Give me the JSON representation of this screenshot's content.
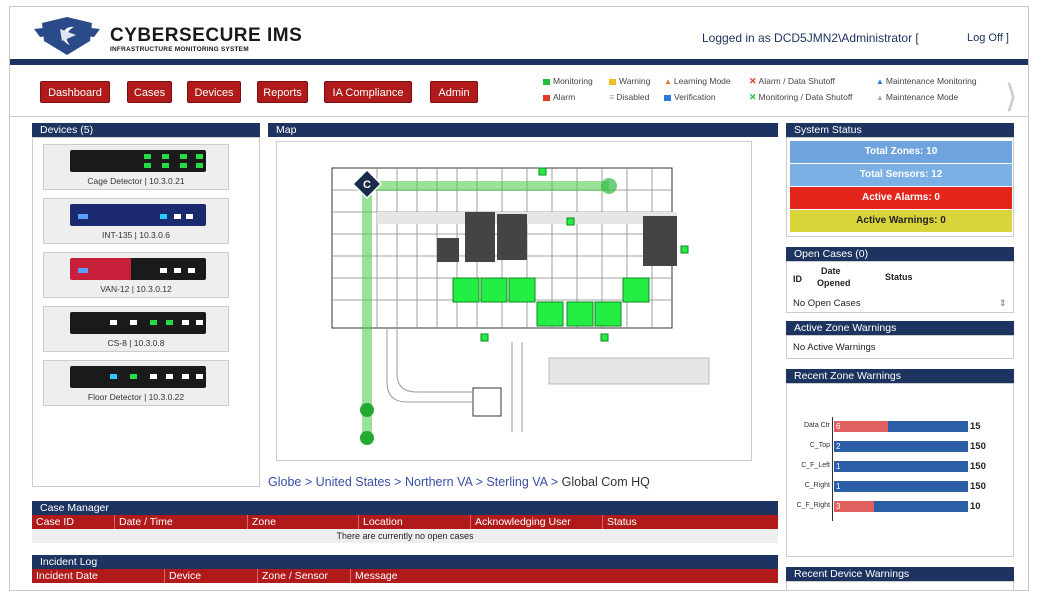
{
  "header": {
    "title": "CYBERSECURE IMS",
    "subtitle": "INFRASTRUCTURE MONITORING SYSTEM",
    "login_text": "Logged in as DCD5JMN2\\Administrator [",
    "logoff": "Log Off ]"
  },
  "nav": [
    "Dashboard",
    "Cases",
    "Devices",
    "Reports",
    "IA Compliance",
    "Admin"
  ],
  "legend": {
    "monitoring": "Monitoring",
    "warning": "Warning",
    "learning": "Learning Mode",
    "alarm_shutoff": "Alarm / Data Shutoff",
    "maint_monitoring": "Maintenance Monitoring",
    "alarm": "Alarm",
    "disabled": "Disabled",
    "verification": "Verification",
    "mon_shutoff": "Monitoring / Data Shutoff",
    "maint_mode": "Maintenance Mode",
    "colors": {
      "monitoring": "#22c03a",
      "warning": "#f0c020",
      "learning": "#e07a20",
      "alarm": "#e03a2a",
      "disabled": "#aaaaaa",
      "verification": "#2a7ae0",
      "maint": "#2a7ae0"
    }
  },
  "devices": {
    "title": "Devices (5)",
    "items": [
      {
        "label": "Cage Detector | 10.3.0.21"
      },
      {
        "label": "INT-135 | 10.3.0.6"
      },
      {
        "label": "VAN-12 | 10.3.0.12"
      },
      {
        "label": "CS-8 | 10.3.0.8"
      },
      {
        "label": "Floor Detector | 10.3.0.22"
      }
    ]
  },
  "map": {
    "title": "Map",
    "marker": "C",
    "breadcrumb": [
      "Globe",
      "United States",
      "Northern VA",
      "Sterling VA"
    ],
    "breadcrumb_current": "Global Com HQ",
    "sep": ">"
  },
  "system_status": {
    "title": "System Status",
    "total_zones": "Total Zones: 10",
    "total_sensors": "Total Sensors: 12",
    "active_alarms": "Active Alarms: 0",
    "active_warnings": "Active Warnings: 0",
    "colors": {
      "zones": "#6fa3dd",
      "sensors": "#7bb0e4",
      "alarms": "#e3251c",
      "warnings": "#d8d43a"
    }
  },
  "open_cases": {
    "title": "Open Cases (0)",
    "col_id": "ID",
    "col_date": "Date",
    "col_opened": "Opened",
    "col_status": "Status",
    "empty": "No Open Cases"
  },
  "active_zone_warnings": {
    "title": "Active Zone Warnings",
    "empty": "No Active Warnings"
  },
  "recent_zone_warnings": {
    "title": "Recent Zone Warnings",
    "rows": [
      {
        "label": "Data Ctr",
        "count": "6",
        "total": "15",
        "red_frac": 0.4
      },
      {
        "label": "C_Top",
        "count": "2",
        "total": "150",
        "red_frac": 0.03
      },
      {
        "label": "C_F_Left",
        "count": "1",
        "total": "150",
        "red_frac": 0.02
      },
      {
        "label": "C_Right",
        "count": "1",
        "total": "150",
        "red_frac": 0.02
      },
      {
        "label": "C_F_Right",
        "count": "3",
        "total": "10",
        "red_frac": 0.3
      }
    ]
  },
  "recent_device_warnings": {
    "title": "Recent Device Warnings"
  },
  "case_manager": {
    "title": "Case Manager",
    "columns": [
      "Case ID",
      "Date / Time",
      "Zone",
      "Location",
      "Acknowledging User",
      "Status"
    ],
    "empty": "There are currently no open cases"
  },
  "incident_log": {
    "title": "Incident Log",
    "columns": [
      "Incident Date",
      "Device",
      "Zone / Sensor",
      "Message"
    ]
  }
}
